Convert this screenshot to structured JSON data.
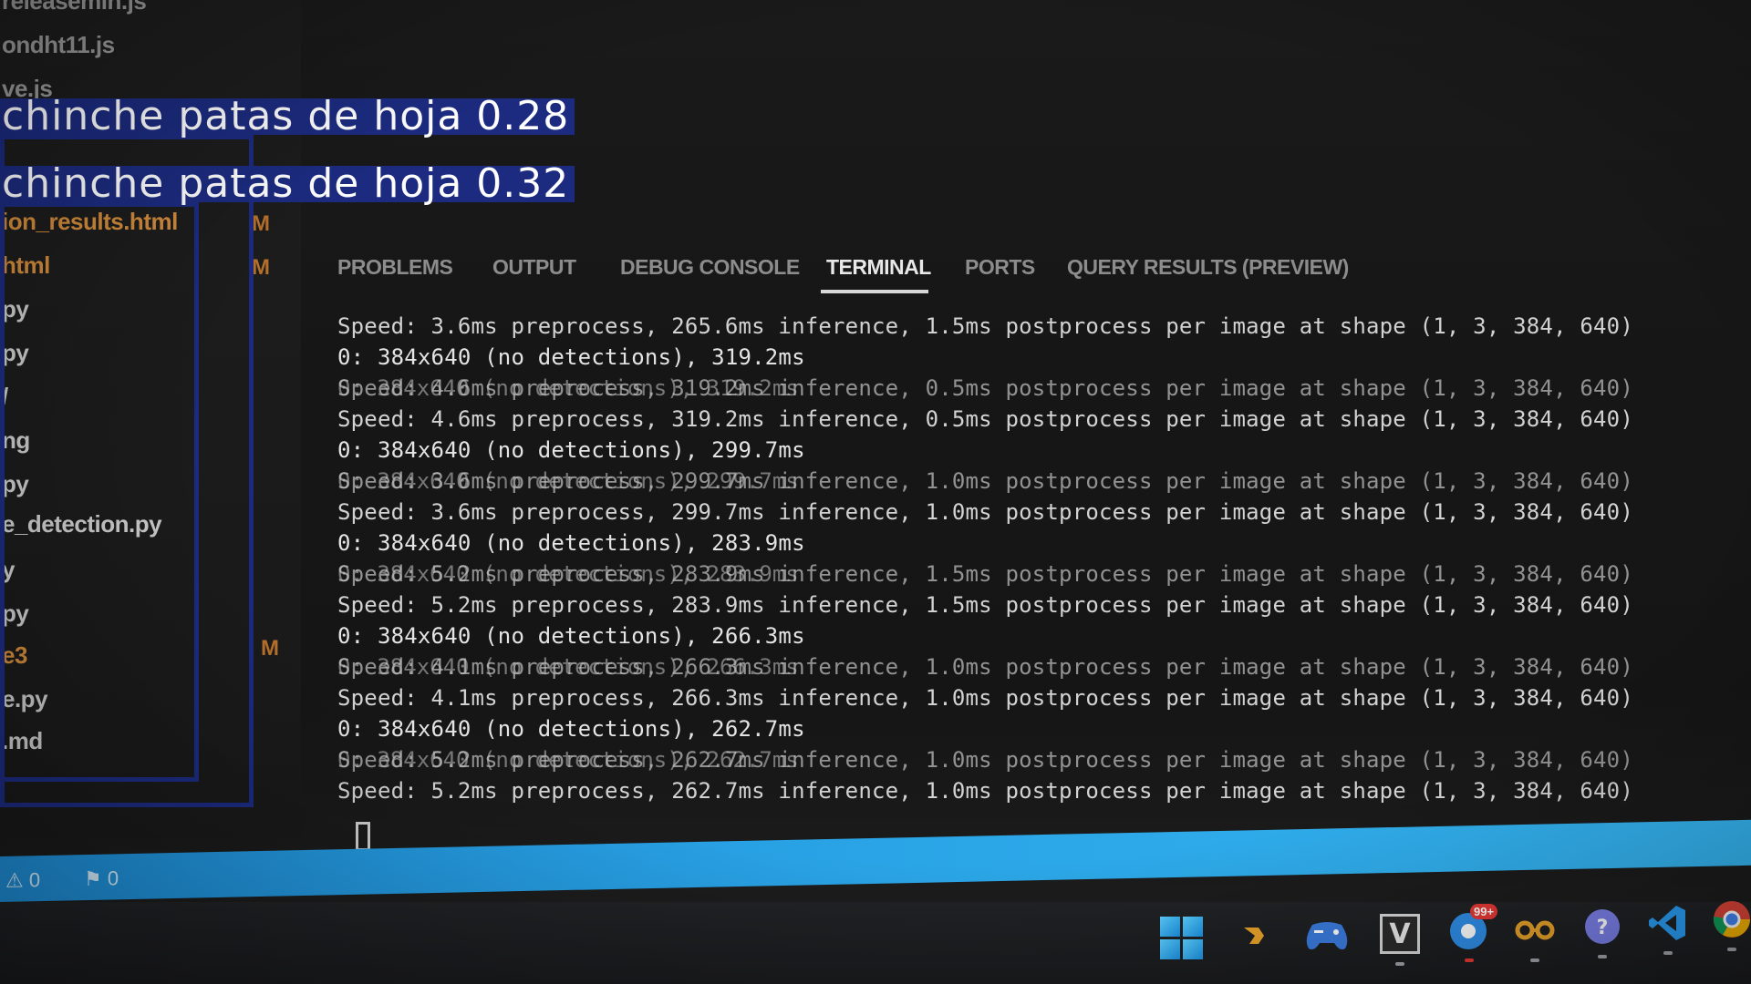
{
  "explorer": {
    "files": [
      {
        "text": "releasemin.js",
        "color": "dim"
      },
      {
        "text": "ondht11.js",
        "color": "dim"
      },
      {
        "text": "ve.js",
        "color": "dim"
      },
      {
        "text": "ion_results.html",
        "color": "orange"
      },
      {
        "text": "html",
        "color": "orange"
      },
      {
        "text": "py",
        "color": "white"
      },
      {
        "text": "py",
        "color": "white"
      },
      {
        "text": "/",
        "color": "white"
      },
      {
        "text": "ng",
        "color": "white"
      },
      {
        "text": "py",
        "color": "white"
      },
      {
        "text": "e_detection.py",
        "color": "white"
      },
      {
        "text": "y",
        "color": "white"
      },
      {
        "text": "py",
        "color": "white"
      },
      {
        "text": "e3",
        "color": "orange"
      },
      {
        "text": "e.py",
        "color": "white"
      },
      {
        "text": ".md",
        "color": "white"
      }
    ],
    "modified_badges": [
      "M",
      "M",
      "M"
    ]
  },
  "panel": {
    "tabs": [
      {
        "label": "PROBLEMS",
        "active": false
      },
      {
        "label": "OUTPUT",
        "active": false
      },
      {
        "label": "DEBUG CONSOLE",
        "active": false
      },
      {
        "label": "TERMINAL",
        "active": true
      },
      {
        "label": "PORTS",
        "active": false
      },
      {
        "label": "QUERY RESULTS (PREVIEW)",
        "active": false
      }
    ]
  },
  "terminal": {
    "lines": [
      {
        "text": "Speed: 3.6ms preprocess, 265.6ms inference, 1.5ms postprocess per image at shape (1, 3, 384, 640)",
        "kind": "speed"
      },
      {
        "text": "0: 384x640 (no detections), 319.2ms",
        "kind": "det"
      },
      {
        "text": "Speed: 4.6ms preprocess, 319.2ms inference, 0.5ms postprocess per image at shape (1, 3, 384, 640)",
        "kind": "ghost"
      },
      {
        "text": "Speed: 4.6ms preprocess, 319.2ms inference, 0.5ms postprocess per image at shape (1, 3, 384, 640)",
        "kind": "speed"
      },
      {
        "text": "0: 384x640 (no detections), 299.7ms",
        "kind": "det"
      },
      {
        "text": "Speed: 3.6ms preprocess, 299.7ms inference, 1.0ms postprocess per image at shape (1, 3, 384, 640)",
        "kind": "ghost"
      },
      {
        "text": "Speed: 3.6ms preprocess, 299.7ms inference, 1.0ms postprocess per image at shape (1, 3, 384, 640)",
        "kind": "speed"
      },
      {
        "text": "0: 384x640 (no detections), 283.9ms",
        "kind": "det"
      },
      {
        "text": "Speed: 5.2ms preprocess, 283.9ms inference, 1.5ms postprocess per image at shape (1, 3, 384, 640)",
        "kind": "ghost"
      },
      {
        "text": "Speed: 5.2ms preprocess, 283.9ms inference, 1.5ms postprocess per image at shape (1, 3, 384, 640)",
        "kind": "speed"
      },
      {
        "text": "0: 384x640 (no detections), 266.3ms",
        "kind": "det"
      },
      {
        "text": "Speed: 4.1ms preprocess, 266.3ms inference, 1.0ms postprocess per image at shape (1, 3, 384, 640)",
        "kind": "ghost"
      },
      {
        "text": "Speed: 4.1ms preprocess, 266.3ms inference, 1.0ms postprocess per image at shape (1, 3, 384, 640)",
        "kind": "speed"
      },
      {
        "text": "0: 384x640 (no detections), 262.7ms",
        "kind": "det"
      },
      {
        "text": "Speed: 5.2ms preprocess, 262.7ms inference, 1.0ms postprocess per image at shape (1, 3, 384, 640)",
        "kind": "ghost"
      },
      {
        "text": "Speed: 5.2ms preprocess, 262.7ms inference, 1.0ms postprocess per image at shape (1, 3, 384, 640)",
        "kind": "speed"
      }
    ],
    "ghost_overlays": [
      "0: 384x640 (no detections), 319.2ms",
      "0: 384x640 (no detections), 299.7ms",
      "0: 384x640 (no detections), 283.9ms",
      "0: 384x640 (no detections), 266.3ms",
      "0: 384x640 (no detections), 262.7ms"
    ]
  },
  "statusbar": {
    "warnings": "⚠ 0",
    "ports": "⚑ 0",
    "color": "#2aa4e6"
  },
  "taskbar": {
    "icons": [
      {
        "name": "windows-start-icon"
      },
      {
        "name": "app-arrow-icon"
      },
      {
        "name": "gamepad-icon"
      },
      {
        "name": "vim-icon",
        "glyph": "V"
      },
      {
        "name": "chat-app-icon"
      },
      {
        "name": "glasses-icon"
      },
      {
        "name": "help-icon"
      },
      {
        "name": "vscode-icon"
      },
      {
        "name": "chrome-icon"
      }
    ],
    "notification_badge": "99+"
  },
  "detections": [
    {
      "label": "chinche patas de hoja 0.28",
      "color": "#1c2b80"
    },
    {
      "label": "chinche patas de hoja 0.32",
      "color": "#1c2b80"
    }
  ]
}
